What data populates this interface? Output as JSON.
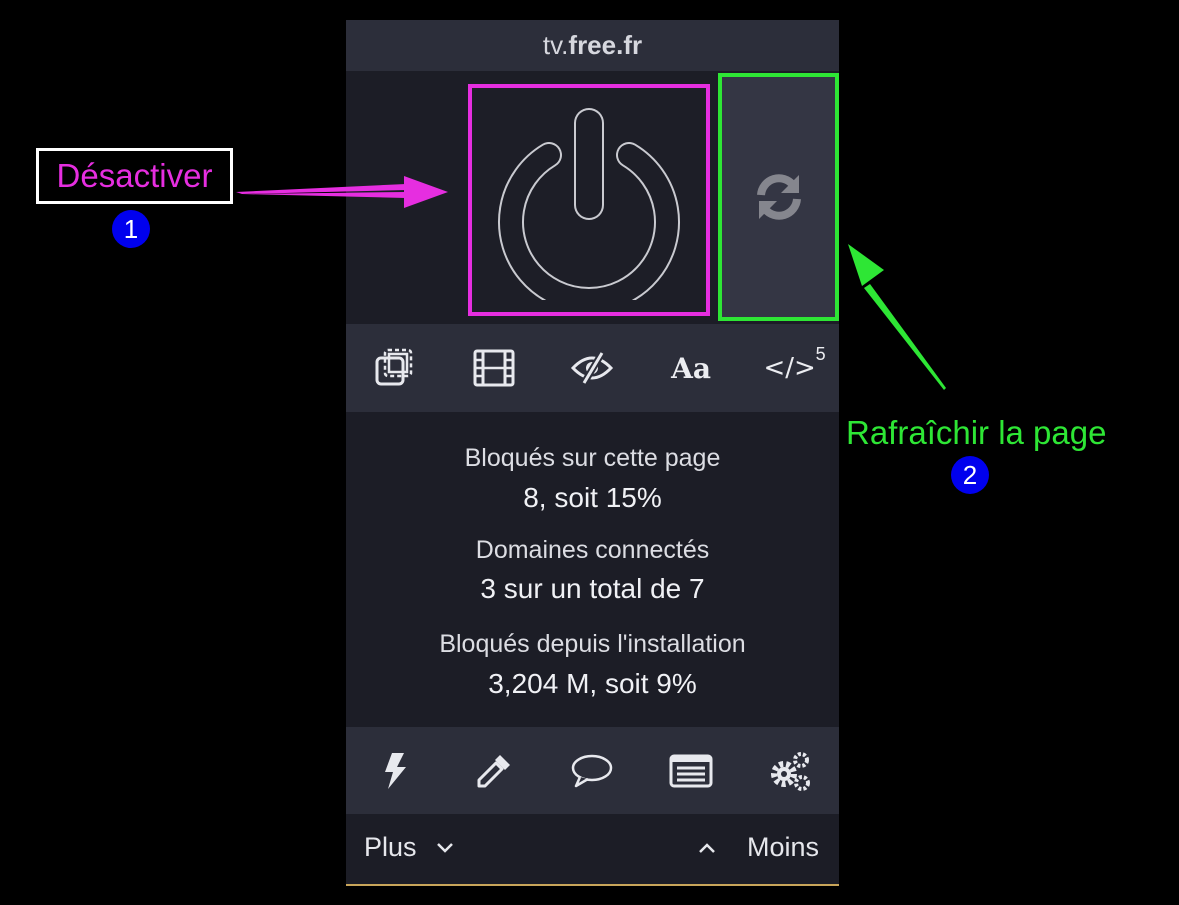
{
  "popup": {
    "hostname_prefix": "tv.",
    "hostname_domain": "free.fr",
    "power_icon": "power-icon",
    "refresh_icon": "refresh-icon",
    "tools": [
      {
        "icon": "element-picker-icon"
      },
      {
        "icon": "media-block-icon"
      },
      {
        "icon": "cosmetic-filter-eye-off-icon"
      },
      {
        "icon": "font-icon",
        "text": "Aa"
      },
      {
        "icon": "script-code-icon",
        "text": "</>",
        "count": "5"
      }
    ],
    "stats": {
      "blocked_page_label": "Bloqués sur cette page",
      "blocked_page_value": "8, soit 15%",
      "domains_label": "Domaines connectés",
      "domains_value": "3 sur un total de 7",
      "blocked_total_label": "Bloqués depuis l'installation",
      "blocked_total_value": "3,204 M, soit 9%"
    },
    "actions": [
      {
        "icon": "lightning-icon"
      },
      {
        "icon": "eyedropper-icon"
      },
      {
        "icon": "speech-bubble-icon"
      },
      {
        "icon": "logger-list-icon"
      },
      {
        "icon": "settings-gears-icon"
      }
    ],
    "more_label": "Plus",
    "less_label": "Moins"
  },
  "annotations": {
    "disable_label": "Désactiver",
    "disable_number": "1",
    "refresh_label": "Rafraîchir la page",
    "refresh_number": "2",
    "colors": {
      "disable": "#e62ee0",
      "refresh": "#2ee635",
      "badge": "#0000ee"
    }
  }
}
